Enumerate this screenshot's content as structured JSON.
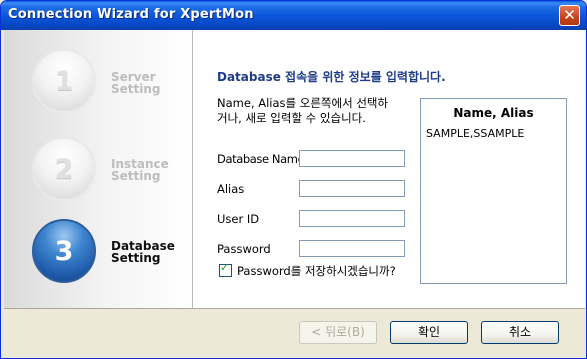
{
  "window": {
    "title": "Connection Wizard for XpertMon"
  },
  "steps": [
    {
      "number": "1",
      "line1": "Server",
      "line2": "Setting",
      "state": "inactive"
    },
    {
      "number": "2",
      "line1": "Instance",
      "line2": "Setting",
      "state": "inactive"
    },
    {
      "number": "3",
      "line1": "Database",
      "line2": "Setting",
      "state": "active"
    }
  ],
  "main": {
    "heading": "Database 접속을 위한 정보를 입력합니다.",
    "instruction_line1": "Name, Alias를 오른쪽에서 선택하",
    "instruction_line2": "거나, 새로 입력할 수 있습니다.",
    "fields": {
      "database_name": {
        "label": "Database Name",
        "value": ""
      },
      "alias": {
        "label": "Alias",
        "value": ""
      },
      "user_id": {
        "label": "User ID",
        "value": ""
      },
      "password": {
        "label": "Password",
        "value": ""
      }
    },
    "save_password": {
      "label": "Password를 저장하시겠습니까?",
      "checked": true
    },
    "list": {
      "header": "Name, Alias",
      "items": [
        "SAMPLE,SSAMPLE"
      ]
    }
  },
  "buttons": {
    "back": "< 뒤로(B)",
    "ok": "확인",
    "cancel": "취소"
  },
  "icons": {
    "close": "close-icon",
    "checkmark": "checkmark-icon"
  },
  "colors": {
    "title_bar": "#0a55d8",
    "heading": "#1f3c88",
    "active_step": "#1d58a8"
  }
}
